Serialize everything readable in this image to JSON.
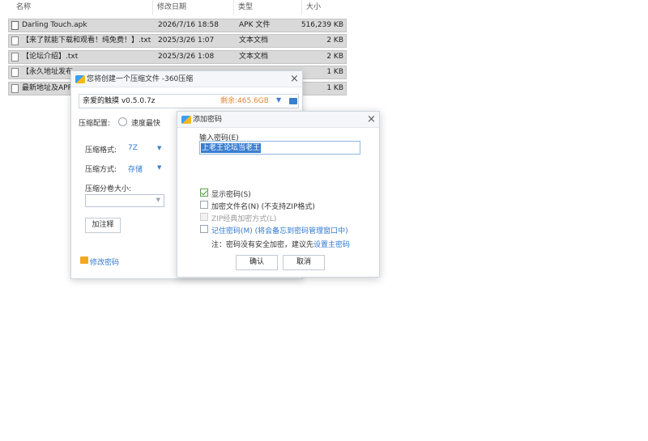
{
  "explorer": {
    "columns": {
      "name": "名称",
      "date": "修改日期",
      "type": "类型",
      "size": "大小"
    },
    "files": [
      {
        "name": "Darling Touch.apk",
        "date": "2026/7/16 18:58",
        "type": "APK 文件",
        "size": "516,239 KB"
      },
      {
        "name": "【来了就能下载和观看！纯免费！】.txt",
        "date": "2025/3/26 1:07",
        "type": "文本文档",
        "size": "2 KB"
      },
      {
        "name": "【论坛介绍】.txt",
        "date": "2025/3/26 1:08",
        "type": "文本文档",
        "size": "2 KB"
      },
      {
        "name": "【永久地址发布",
        "date": "",
        "type": "",
        "size": "1 KB"
      },
      {
        "name": "最新地址及APP",
        "date": "",
        "type": "",
        "size": "1 KB"
      }
    ]
  },
  "zip_dialog": {
    "title": "您将创建一个压缩文件 -360压缩",
    "filename": "亲爱的触摸  v0.5.0.7z",
    "free_space": "剩余:465.6GB",
    "config_label": "压缩配置:",
    "config_option": "速度最快",
    "format_label": "压缩格式:",
    "format_value": "7Z",
    "method_label": "压缩方式:",
    "method_value": "存储",
    "volume_label": "压缩分卷大小:",
    "volume_value": "",
    "comment_button": "加注释",
    "change_password_link": "修改密码"
  },
  "password_dialog": {
    "title": "添加密码",
    "input_label": "输入密码(E)",
    "password_value": "上老王论坛当老王",
    "show_password": "显示密码(S)",
    "encrypt_names": "加密文件名(N) (不支持ZIP格式)",
    "zip_classic": "ZIP经典加密方式(L)",
    "remember_password": "记住密码(M) (将会备忘到密码管理窗口中)",
    "note_prefix": "注：密码没有安全加密，建议先",
    "note_link": "设置主密码",
    "ok_button": "确认",
    "cancel_button": "取消"
  },
  "colors": {
    "accent": "#3b7ed0",
    "free_space": "#e0862f",
    "link": "#2f79d0"
  },
  "icons": {
    "file": "file-icon",
    "app": "app-icon",
    "close": "close-icon",
    "lock": "lock-icon",
    "folder": "folder-icon"
  }
}
